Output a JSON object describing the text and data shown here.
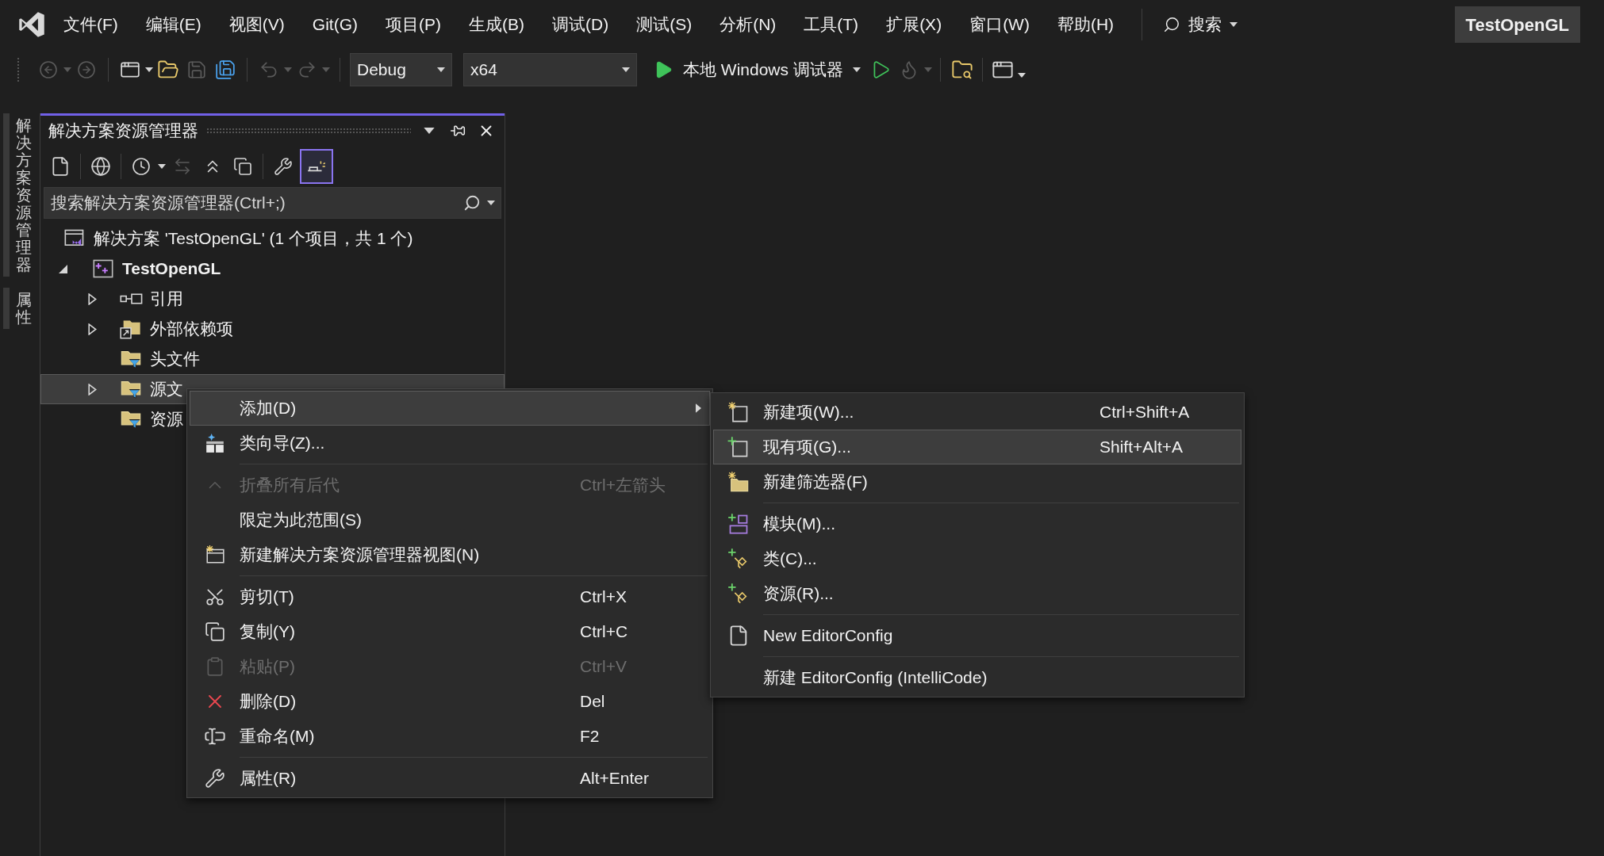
{
  "menu_bar": [
    {
      "label": "文件(F)"
    },
    {
      "label": "编辑(E)"
    },
    {
      "label": "视图(V)"
    },
    {
      "label": "Git(G)"
    },
    {
      "label": "项目(P)"
    },
    {
      "label": "生成(B)"
    },
    {
      "label": "调试(D)"
    },
    {
      "label": "测试(S)"
    },
    {
      "label": "分析(N)"
    },
    {
      "label": "工具(T)"
    },
    {
      "label": "扩展(X)"
    },
    {
      "label": "窗口(W)"
    },
    {
      "label": "帮助(H)"
    }
  ],
  "search": {
    "label": "搜索"
  },
  "solution_badge": "TestOpenGL",
  "toolbar": {
    "configuration": "Debug",
    "platform": "x64",
    "run_label": "本地 Windows 调试器"
  },
  "side_tabs": [
    {
      "label": "解决方案资源管理器"
    },
    {
      "label": "属性"
    }
  ],
  "solution_explorer": {
    "title": "解决方案资源管理器",
    "preview_toggle": {
      "on": true
    },
    "search_placeholder": "搜索解决方案资源管理器(Ctrl+;)",
    "tree": [
      {
        "kind": "solution",
        "label": "解决方案 'TestOpenGL' (1 个项目，共 1 个)",
        "selected": false,
        "children": [
          {
            "kind": "project",
            "label": "TestOpenGL",
            "expanded": true,
            "selected": false,
            "children": [
              {
                "kind": "references",
                "label": "引用",
                "expanded": false,
                "selected": false
              },
              {
                "kind": "external",
                "label": "外部依赖项",
                "expanded": false,
                "selected": false
              },
              {
                "kind": "filter",
                "label": "头文件",
                "selected": false
              },
              {
                "kind": "filter",
                "label": "源文",
                "expanded": false,
                "selected": true
              },
              {
                "kind": "filter",
                "label": "资源",
                "selected": false
              }
            ]
          }
        ]
      }
    ]
  },
  "context_menu": [
    {
      "kind": "item",
      "label": "添加(D)",
      "has_submenu": true,
      "selected": true,
      "disabled": false
    },
    {
      "kind": "item",
      "label": "类向导(Z)...",
      "has_submenu": false,
      "selected": false,
      "disabled": false
    },
    {
      "kind": "separator"
    },
    {
      "kind": "item",
      "label": "折叠所有后代",
      "shortcut": "Ctrl+左箭头",
      "has_submenu": false,
      "selected": false,
      "disabled": true
    },
    {
      "kind": "item",
      "label": "限定为此范围(S)",
      "has_submenu": false,
      "selected": false,
      "disabled": false
    },
    {
      "kind": "item",
      "label": "新建解决方案资源管理器视图(N)",
      "has_submenu": false,
      "selected": false,
      "disabled": false
    },
    {
      "kind": "separator"
    },
    {
      "kind": "item",
      "label": "剪切(T)",
      "shortcut": "Ctrl+X",
      "has_submenu": false,
      "selected": false,
      "disabled": false
    },
    {
      "kind": "item",
      "label": "复制(Y)",
      "shortcut": "Ctrl+C",
      "has_submenu": false,
      "selected": false,
      "disabled": false
    },
    {
      "kind": "item",
      "label": "粘贴(P)",
      "shortcut": "Ctrl+V",
      "has_submenu": false,
      "selected": false,
      "disabled": true
    },
    {
      "kind": "item",
      "label": "删除(D)",
      "shortcut": "Del",
      "has_submenu": false,
      "selected": false,
      "disabled": false
    },
    {
      "kind": "item",
      "label": "重命名(M)",
      "shortcut": "F2",
      "has_submenu": false,
      "selected": false,
      "disabled": false
    },
    {
      "kind": "separator"
    },
    {
      "kind": "item",
      "label": "属性(R)",
      "shortcut": "Alt+Enter",
      "has_submenu": false,
      "selected": false,
      "disabled": false
    }
  ],
  "add_submenu": [
    {
      "kind": "item",
      "label": "新建项(W)...",
      "shortcut": "Ctrl+Shift+A",
      "selected": false
    },
    {
      "kind": "item",
      "label": "现有项(G)...",
      "shortcut": "Shift+Alt+A",
      "selected": true
    },
    {
      "kind": "item",
      "label": "新建筛选器(F)",
      "selected": false
    },
    {
      "kind": "separator"
    },
    {
      "kind": "item",
      "label": "模块(M)...",
      "selected": false
    },
    {
      "kind": "item",
      "label": "类(C)...",
      "selected": false
    },
    {
      "kind": "item",
      "label": "资源(R)...",
      "selected": false
    },
    {
      "kind": "separator"
    },
    {
      "kind": "item",
      "label": "New EditorConfig",
      "selected": false
    },
    {
      "kind": "separator"
    },
    {
      "kind": "item",
      "label": "新建 EditorConfig (IntelliCode)",
      "selected": false
    }
  ]
}
